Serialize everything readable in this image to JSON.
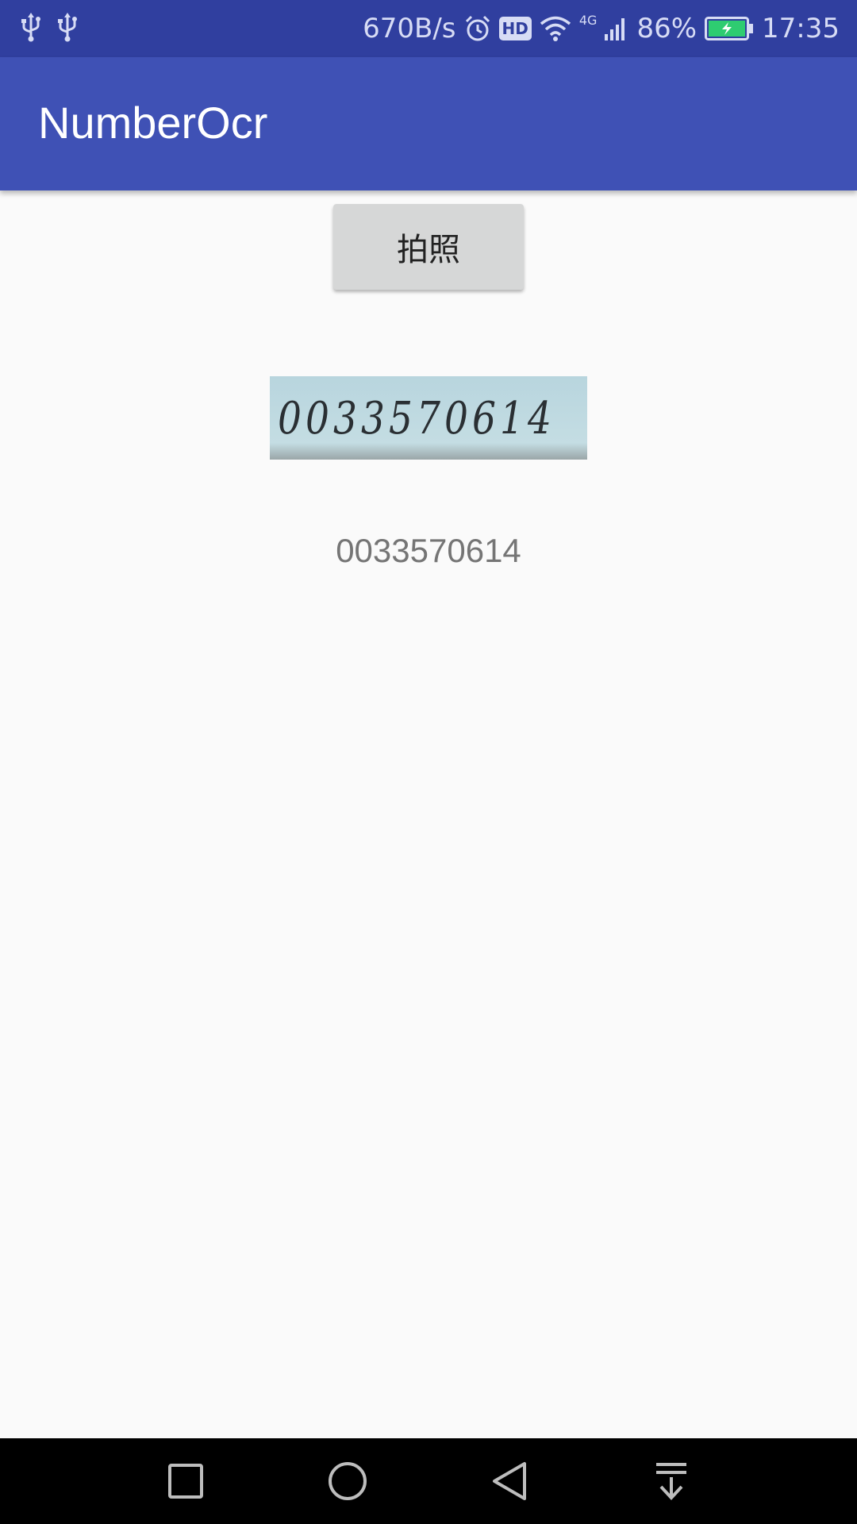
{
  "status_bar": {
    "network_speed": "670B/s",
    "hd_badge": "HD",
    "signal_type": "4G",
    "battery_percent": "86%",
    "time": "17:35",
    "icons": [
      "usb-icon",
      "usb-icon",
      "alarm-icon",
      "hd-icon",
      "wifi-icon",
      "cell-signal-icon",
      "battery-charging-icon"
    ]
  },
  "app_bar": {
    "title": "NumberOcr"
  },
  "main": {
    "capture_button_label": "拍照",
    "captured_image_digits": "0033570614",
    "result_text": "0033570614"
  },
  "nav_bar": {
    "icons": [
      "recents-icon",
      "home-icon",
      "back-icon",
      "notification-pull-icon"
    ]
  },
  "colors": {
    "status_bar": "#303f9f",
    "app_bar": "#3f51b5",
    "background": "#fafafa",
    "button": "#d6d7d7",
    "result_text": "#757575",
    "nav_bar": "#000000"
  }
}
